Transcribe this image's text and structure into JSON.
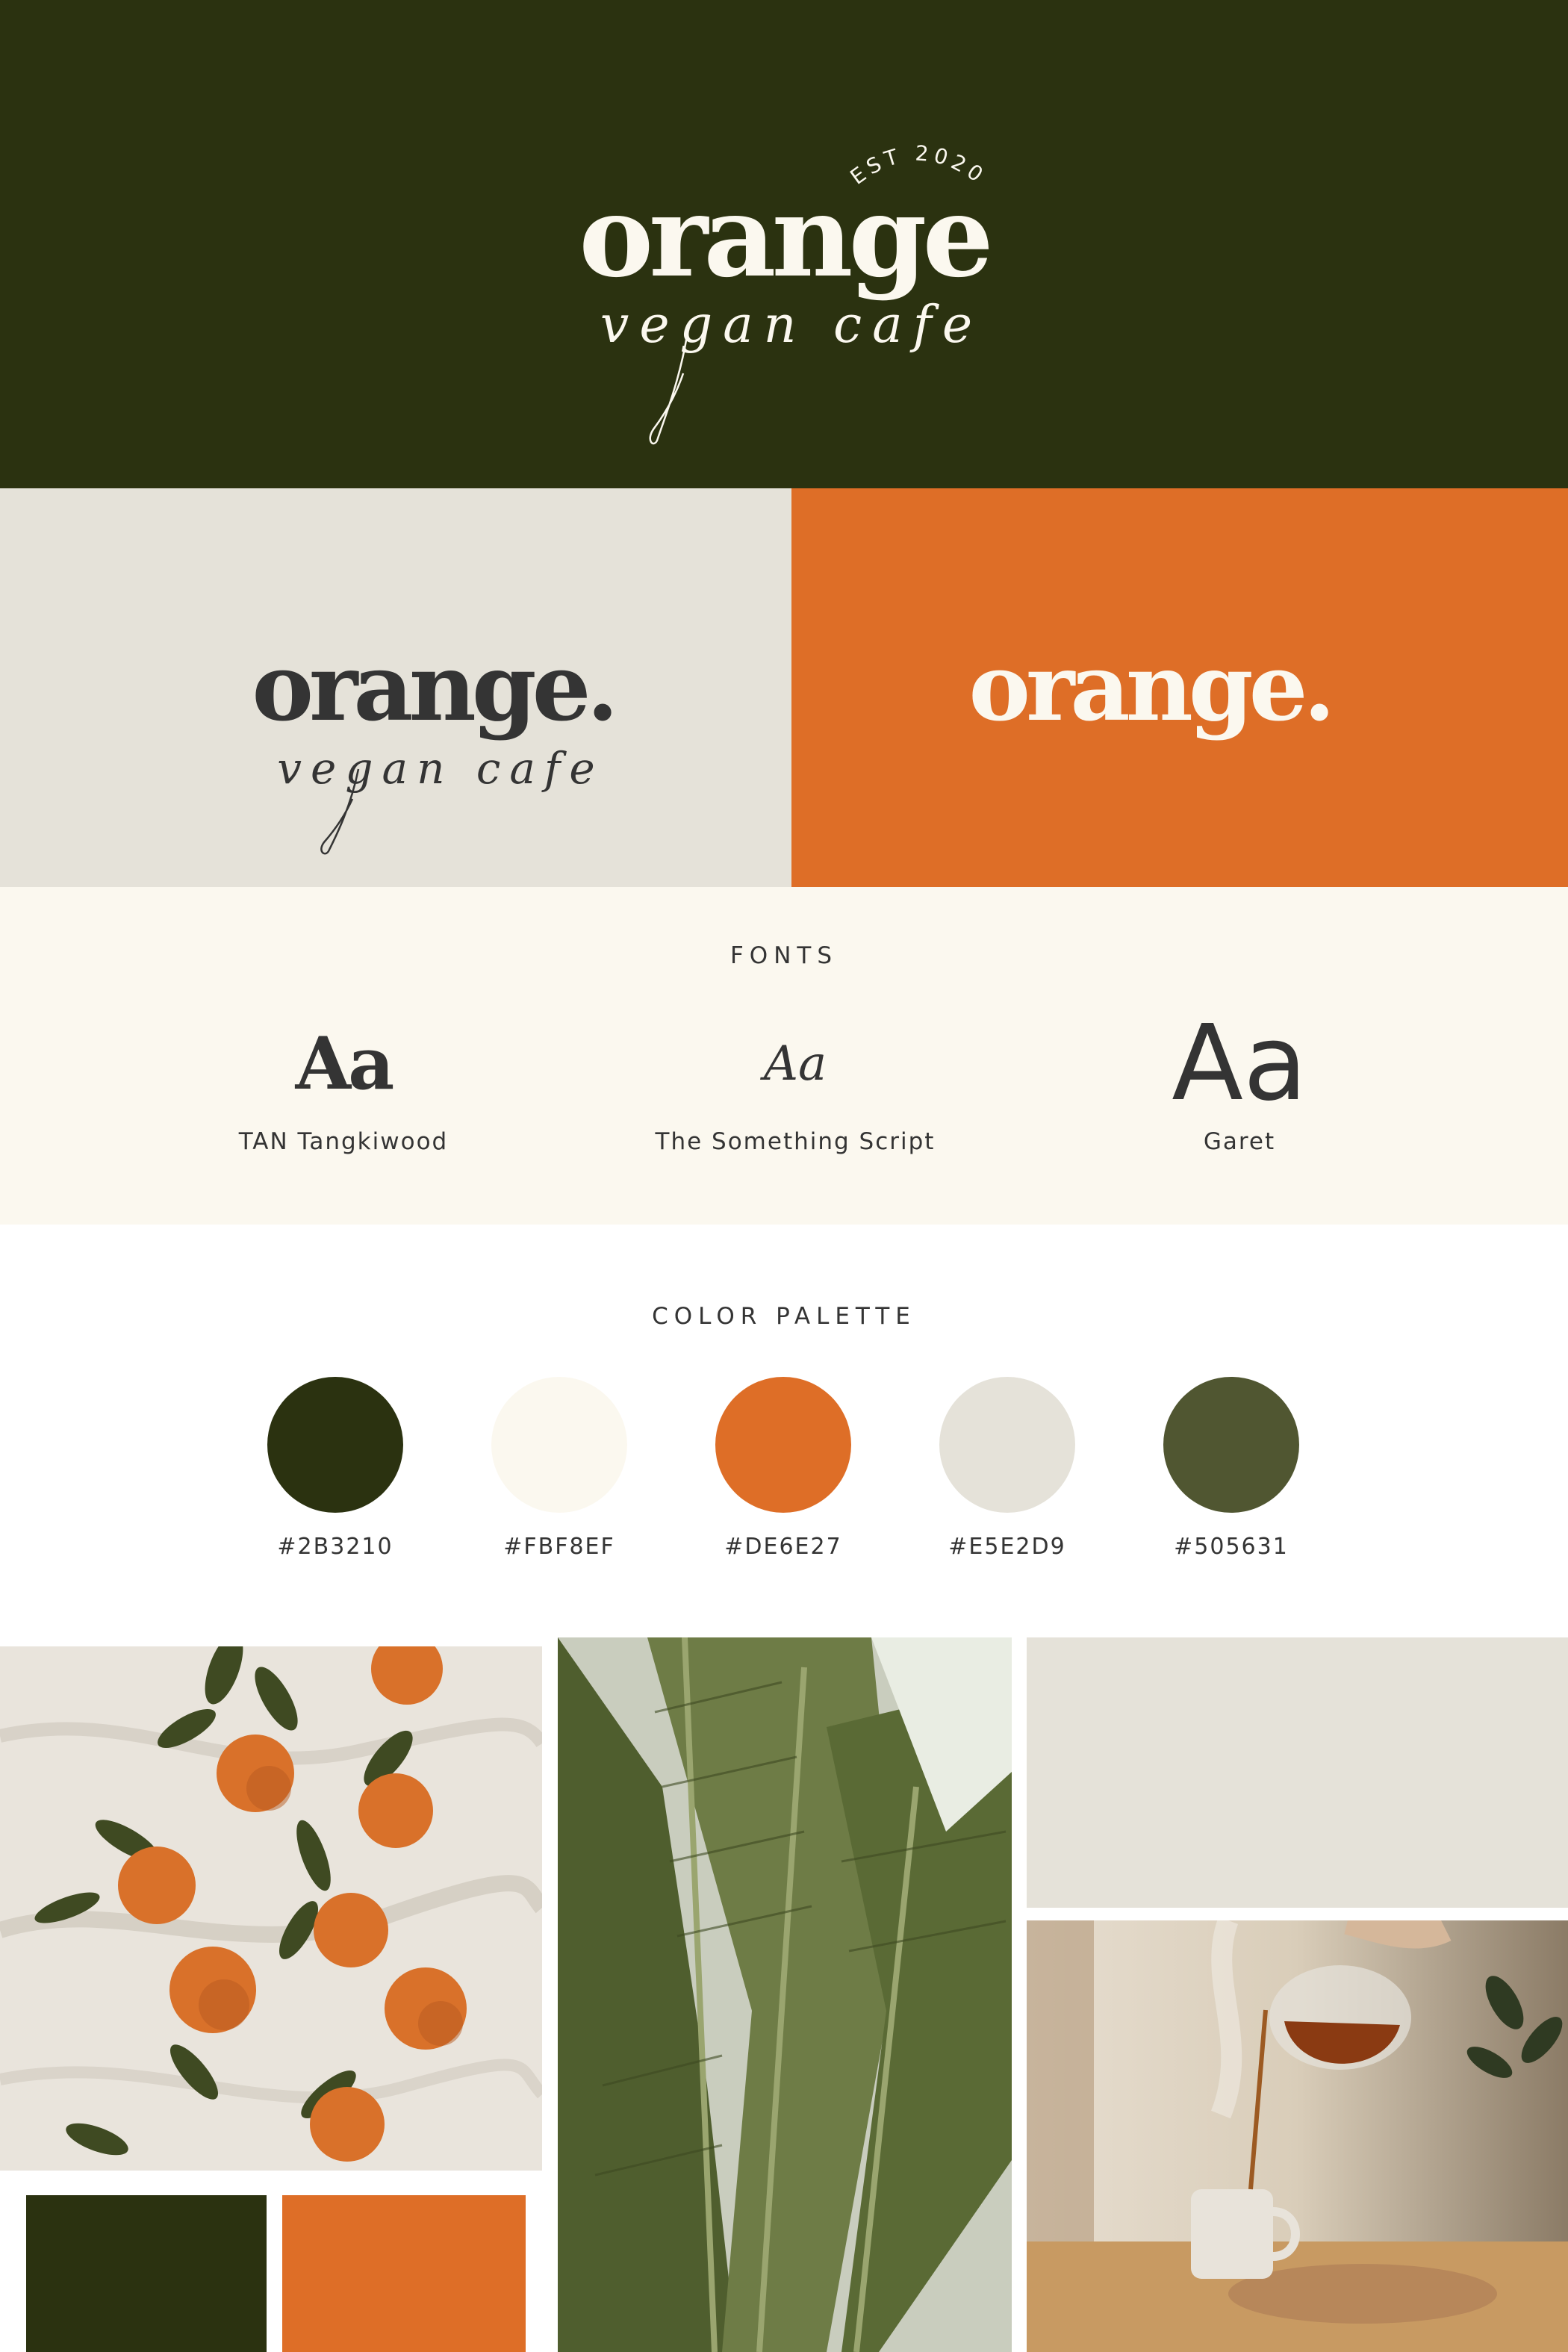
{
  "brand": {
    "est_text": "EST 2020",
    "hero_wordmark": "orange",
    "hero_script": "vegan cafe",
    "variant_wordmark": "orange.",
    "variant_script": "vegan cafe"
  },
  "fonts": {
    "title": "FONTS",
    "items": [
      {
        "sample": "Aa",
        "name": "TAN Tangkiwood"
      },
      {
        "sample": "Aa",
        "name": "The Something Script"
      },
      {
        "sample": "Aa",
        "name": "Garet"
      }
    ]
  },
  "palette": {
    "title": "COLOR PALETTE",
    "swatches": [
      {
        "hex": "#2B3210",
        "label": "#2B3210"
      },
      {
        "hex": "#FBF8EF",
        "label": "#FBF8EF"
      },
      {
        "hex": "#DE6E27",
        "label": "#DE6E27"
      },
      {
        "hex": "#E5E2D9",
        "label": "#E5E2D9"
      },
      {
        "hex": "#505631",
        "label": "#505631"
      }
    ]
  },
  "colors": {
    "dark_green": "#2B3210",
    "cream": "#FBF8EF",
    "orange": "#DE6E27",
    "light_grey": "#E5E2D9",
    "olive": "#505631",
    "text": "#343434"
  },
  "moodboard": {
    "images": [
      "oranges-on-linen-photo",
      "banana-leaves-photo",
      "pouring-tea-photo"
    ]
  }
}
